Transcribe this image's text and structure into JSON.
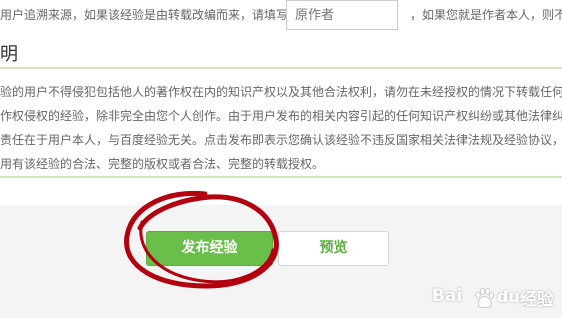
{
  "source": {
    "prefix": "用户追溯来源，如果该经验是由转载改编而来，请填写",
    "author_placeholder": "原作者",
    "suffix": "，如果您就是作者本人，则不"
  },
  "statement": {
    "title": "明",
    "lines": [
      "验的用户不得侵犯包括他人的著作权在内的知识产权以及其他合法权利，请勿在未经授权的情况下转载任何",
      "作权侵权的经验，除非完全由您个人创作。由于用户发布的相关内容引起的任何知识产权纠纷或其他法律纠",
      "责任在于用户本人，与百度经验无关。点击发布即表示您确认该经验不违反国家相关法律法规及经验协议，",
      "用有该经验的合法、完整的版权或者合法、完整的转载授权。"
    ]
  },
  "actions": {
    "publish_label": "发布经验",
    "preview_label": "预览"
  },
  "colors": {
    "accent_green": "#6abf4b",
    "divider_green": "#cfe4bf",
    "annotation_red": "#b3000f"
  },
  "watermark": {
    "prefix": "Bai",
    "suffix": "du",
    "product": "经验"
  }
}
